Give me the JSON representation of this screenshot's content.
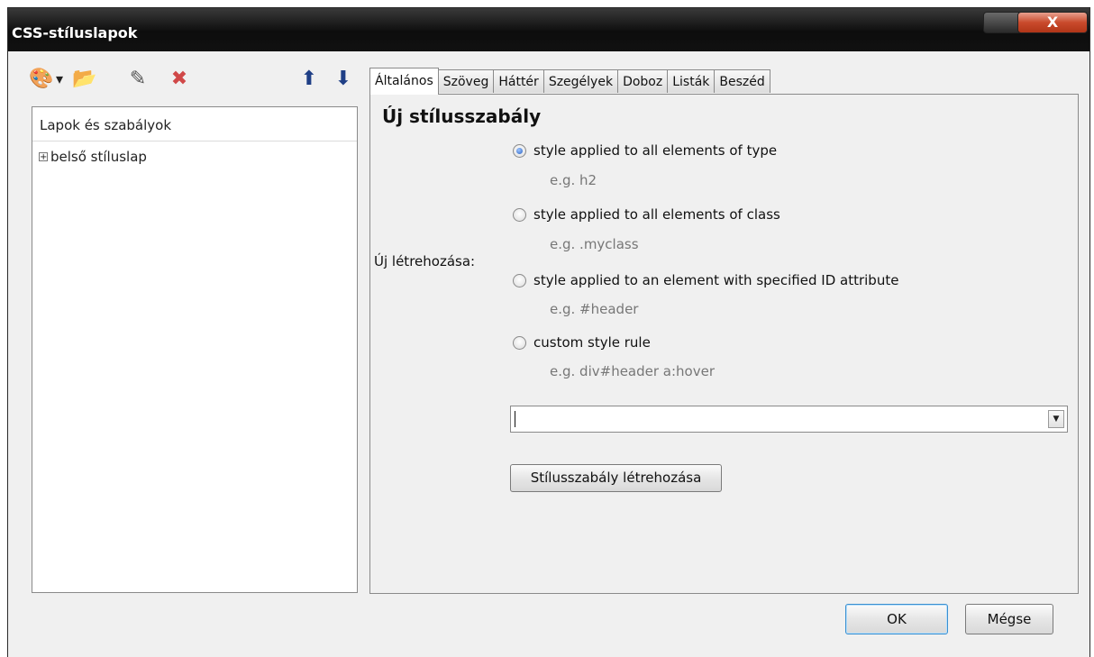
{
  "window": {
    "title": "CSS-stíluslapok",
    "close_glyph": "X"
  },
  "toolbar": {
    "icons": [
      "palette-icon",
      "dropdown-arrow-icon",
      "import-icon",
      "edit-icon",
      "delete-icon",
      "move-up-icon",
      "move-down-icon"
    ],
    "glyphs": {
      "palette": "🎨",
      "dropdown": "▾",
      "import": "📂",
      "edit": "✎",
      "delete": "✖",
      "up": "⬆",
      "down": "⬇"
    }
  },
  "tree": {
    "header": "Lapok és szabályok",
    "items": [
      {
        "expander": "+",
        "label": "belső stíluslap"
      }
    ]
  },
  "tabs": [
    {
      "label": "Általános",
      "active": true
    },
    {
      "label": "Szöveg"
    },
    {
      "label": "Háttér"
    },
    {
      "label": "Szegélyek"
    },
    {
      "label": "Doboz"
    },
    {
      "label": "Listák"
    },
    {
      "label": "Beszéd"
    }
  ],
  "panel": {
    "title": "Új stílusszabály",
    "new_label": "Új létrehozása:",
    "options": [
      {
        "label": "style applied to all elements of type",
        "example": "e.g. h2",
        "checked": true
      },
      {
        "label": "style applied to all elements of class",
        "example": "e.g. .myclass",
        "checked": false
      },
      {
        "label": "style applied to an element with specified ID attribute",
        "example": "e.g. #header",
        "checked": false
      },
      {
        "label": "custom style rule",
        "example": "e.g. div#header a:hover",
        "checked": false
      }
    ],
    "selector_value": "",
    "create_button": "Stílusszabály létrehozása"
  },
  "footer": {
    "ok": "OK",
    "cancel": "Mégse"
  }
}
